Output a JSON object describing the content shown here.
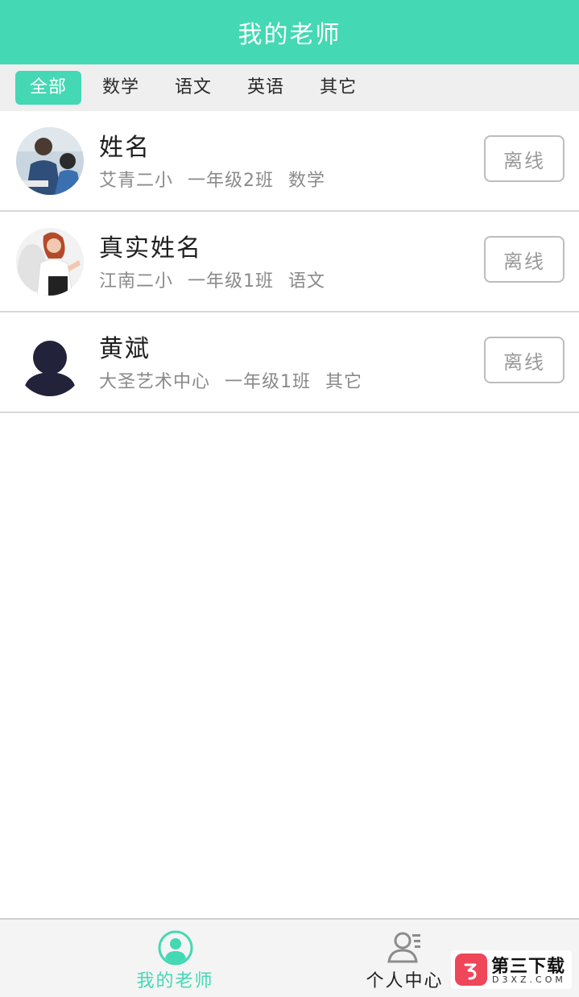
{
  "header": {
    "title": "我的老师"
  },
  "tabs": [
    {
      "label": "全部",
      "active": true
    },
    {
      "label": "数学",
      "active": false
    },
    {
      "label": "语文",
      "active": false
    },
    {
      "label": "英语",
      "active": false
    },
    {
      "label": "其它",
      "active": false
    }
  ],
  "teachers": [
    {
      "name": "姓名",
      "school": "艾青二小",
      "class": "一年级2班",
      "subject": "数学",
      "status": "离线",
      "avatar": "photo-avatar-icon"
    },
    {
      "name": "真实姓名",
      "school": "江南二小",
      "class": "一年级1班",
      "subject": "语文",
      "status": "离线",
      "avatar": "photo-avatar-icon"
    },
    {
      "name": "黄斌",
      "school": "大圣艺术中心",
      "class": "一年级1班",
      "subject": "其它",
      "status": "离线",
      "avatar": "default-user-icon"
    }
  ],
  "bottom_nav": {
    "teachers_label": "我的老师",
    "profile_label": "个人中心"
  },
  "watermark": {
    "title": "第三下载",
    "sub": "D3XZ.COM"
  },
  "colors": {
    "accent": "#44d8b4",
    "tab_bg": "#efefef",
    "status_border": "#bdbdbd"
  }
}
